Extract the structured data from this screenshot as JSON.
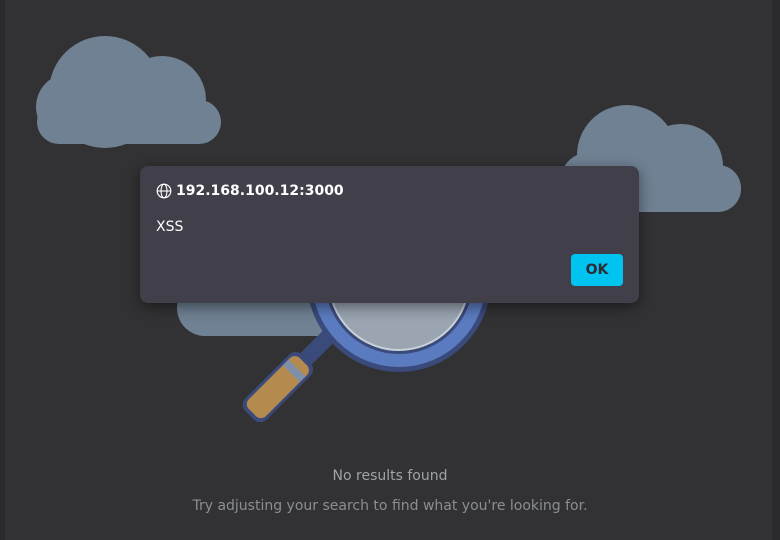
{
  "empty_state": {
    "title": "No results found",
    "subtitle": "Try adjusting your search to find what you're looking for.",
    "illustration_icon": "magnifying-glass-clouds"
  },
  "alert_dialog": {
    "origin": "192.168.100.12:3000",
    "message": "XSS",
    "ok_label": "OK",
    "origin_icon": "globe-icon"
  },
  "colors": {
    "background": "#323234",
    "dialog_background": "#403f4a",
    "ok_button": "#00c4ef",
    "cloud": "#6f8193"
  }
}
